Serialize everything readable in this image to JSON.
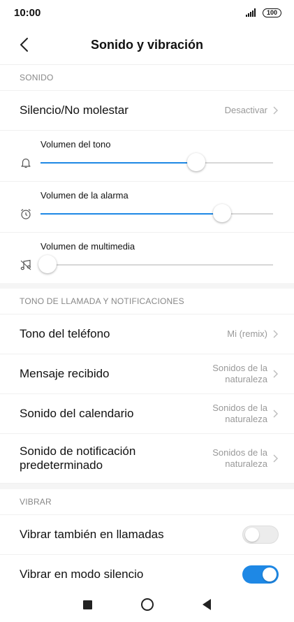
{
  "status": {
    "time": "10:00",
    "battery": "100"
  },
  "header": {
    "title": "Sonido y vibración"
  },
  "sonido": {
    "label": "SONIDO",
    "silencio": {
      "label": "Silencio/No molestar",
      "value": "Desactivar"
    },
    "volumes": [
      {
        "label": "Volumen del tono",
        "icon": "bell-icon",
        "level": 0.67
      },
      {
        "label": "Volumen de la alarma",
        "icon": "alarm-clock-icon",
        "level": 0.78
      },
      {
        "label": "Volumen de multimedia",
        "icon": "music-note-icon",
        "level": 0.03
      }
    ]
  },
  "tonos": {
    "label": "TONO DE LLAMADA Y NOTIFICACIONES",
    "items": [
      {
        "label": "Tono del teléfono",
        "value": "Mi (remix)"
      },
      {
        "label": "Mensaje recibido",
        "value1": "Sonidos de la",
        "value2": "naturaleza"
      },
      {
        "label": "Sonido del calendario",
        "value1": "Sonidos de la",
        "value2": "naturaleza"
      },
      {
        "label1": "Sonido de notificación",
        "label2": "predeterminado",
        "value1": "Sonidos de la",
        "value2": "naturaleza"
      }
    ]
  },
  "vibrar": {
    "label": "VIBRAR",
    "items": [
      {
        "label": "Vibrar también en llamadas",
        "on": false
      },
      {
        "label": "Vibrar en modo silencio",
        "on": true
      }
    ]
  },
  "colors": {
    "accent": "#1e88e5",
    "track": "#d7d7d7"
  }
}
